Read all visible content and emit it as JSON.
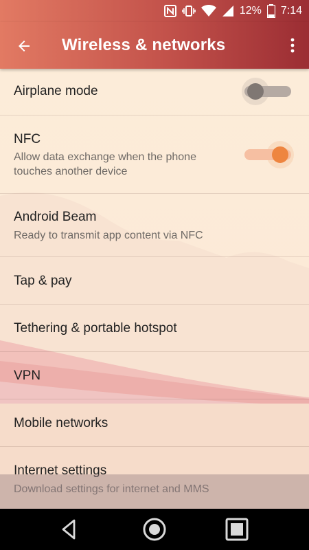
{
  "status": {
    "battery": "12%",
    "time": "7:14"
  },
  "app_bar": {
    "title": "Wireless & networks"
  },
  "icons": {
    "back": "arrow-left",
    "more": "vertical-dots",
    "nfc": "nfc-n-icon",
    "vibrate": "vibrate-icon",
    "wifi": "wifi-icon",
    "signal": "cell-signal-icon",
    "battery": "battery-icon"
  },
  "settings": {
    "airplane": {
      "title": "Airplane mode",
      "enabled": false
    },
    "nfc": {
      "title": "NFC",
      "subtitle": "Allow data exchange when the phone touches another device",
      "enabled": true
    },
    "beam": {
      "title": "Android Beam",
      "subtitle": "Ready to transmit app content via NFC"
    },
    "tap_pay": {
      "title": "Tap & pay"
    },
    "tethering": {
      "title": "Tethering & portable hotspot"
    },
    "vpn": {
      "title": "VPN"
    },
    "mobile": {
      "title": "Mobile networks"
    },
    "internet": {
      "title": "Internet settings",
      "subtitle": "Download settings for internet and MMS"
    }
  },
  "colors": {
    "accent": "#ee8540",
    "toggle_on_track": "#f6bfa2",
    "toggle_off_track": "#b5aaa3",
    "toggle_off_thumb": "#7f7773",
    "header_start": "#e27a63",
    "header_end": "#9b2d33"
  },
  "nav": {
    "back": "triangle-back-icon",
    "home": "circle-home-icon",
    "recents": "square-recents-icon"
  }
}
